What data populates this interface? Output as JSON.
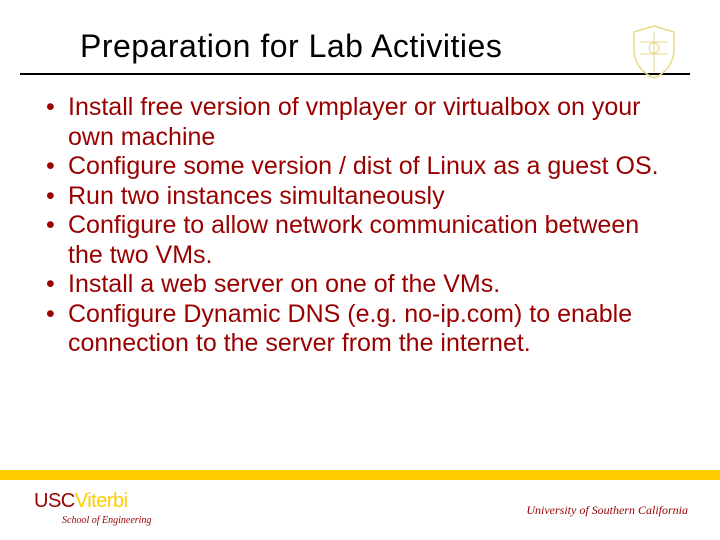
{
  "title": "Preparation for Lab Activities",
  "bullets": [
    "Install free version of vmplayer or virtualbox on your own machine",
    "Configure some version / dist of Linux as a guest OS.",
    "Run two instances simultaneously",
    "Configure to allow network communication between the two VMs.",
    "Install a web server on one of the VMs.",
    "Configure Dynamic DNS (e.g. no-ip.com) to enable connection to the server from the internet."
  ],
  "footer": {
    "logo_usc": "USC",
    "logo_viterbi": "Viterbi",
    "logo_sub": "School of Engineering",
    "university": "University of Southern California"
  },
  "colors": {
    "cardinal": "#990000",
    "gold": "#FFCC00"
  }
}
